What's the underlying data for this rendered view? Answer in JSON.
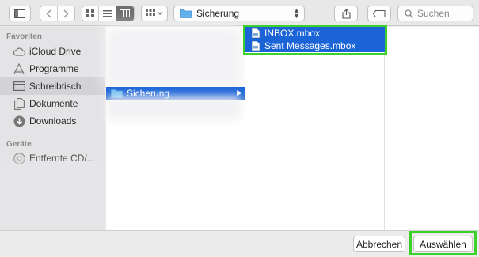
{
  "toolbar": {
    "path_folder": "Sicherung",
    "search_placeholder": "Suchen"
  },
  "sidebar": {
    "favorites_heading": "Favoriten",
    "favorites": [
      {
        "label": "iCloud Drive",
        "icon": "cloud-icon"
      },
      {
        "label": "Programme",
        "icon": "apps-icon"
      },
      {
        "label": "Schreibtisch",
        "icon": "desktop-icon",
        "selected": true
      },
      {
        "label": "Dokumente",
        "icon": "documents-icon"
      },
      {
        "label": "Downloads",
        "icon": "downloads-icon"
      }
    ],
    "devices_heading": "Geräte",
    "devices": [
      {
        "label": "Entfernte CD/...",
        "icon": "disc-icon"
      }
    ]
  },
  "columns": {
    "col1_selected": "Sicherung",
    "col2_files": [
      "INBOX.mbox",
      "Sent Messages.mbox"
    ]
  },
  "footer": {
    "cancel_label": "Abbrechen",
    "choose_label": "Auswählen"
  },
  "colors": {
    "selection": "#1b64d8",
    "highlight_box": "#3bd12a"
  }
}
